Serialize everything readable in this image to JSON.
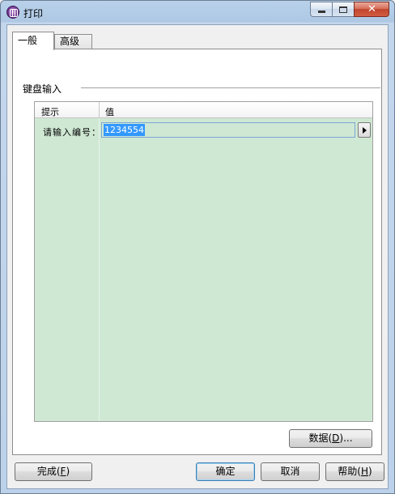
{
  "window": {
    "title": "打印",
    "app_icon": "print-app-icon"
  },
  "tabs": [
    {
      "label": "一般",
      "active": true
    },
    {
      "label": "高级",
      "active": false
    }
  ],
  "group": {
    "label": "键盘输入"
  },
  "grid": {
    "columns": [
      "提示",
      "值"
    ],
    "rows": [
      {
        "hint": "请输入编号：",
        "value": "1234554"
      }
    ]
  },
  "buttons": {
    "data_label": "数据(",
    "data_key": "D",
    "data_tail": ")...",
    "finish_label": "完成(",
    "finish_key": "F",
    "finish_tail": ")",
    "ok_label": "确定",
    "cancel_label": "取消",
    "help_label": "帮助(",
    "help_key": "H",
    "help_tail": ")"
  },
  "colors": {
    "grid_bg": "#cfe8d3",
    "selection": "#3399ff",
    "close_button": "#c0462f"
  }
}
